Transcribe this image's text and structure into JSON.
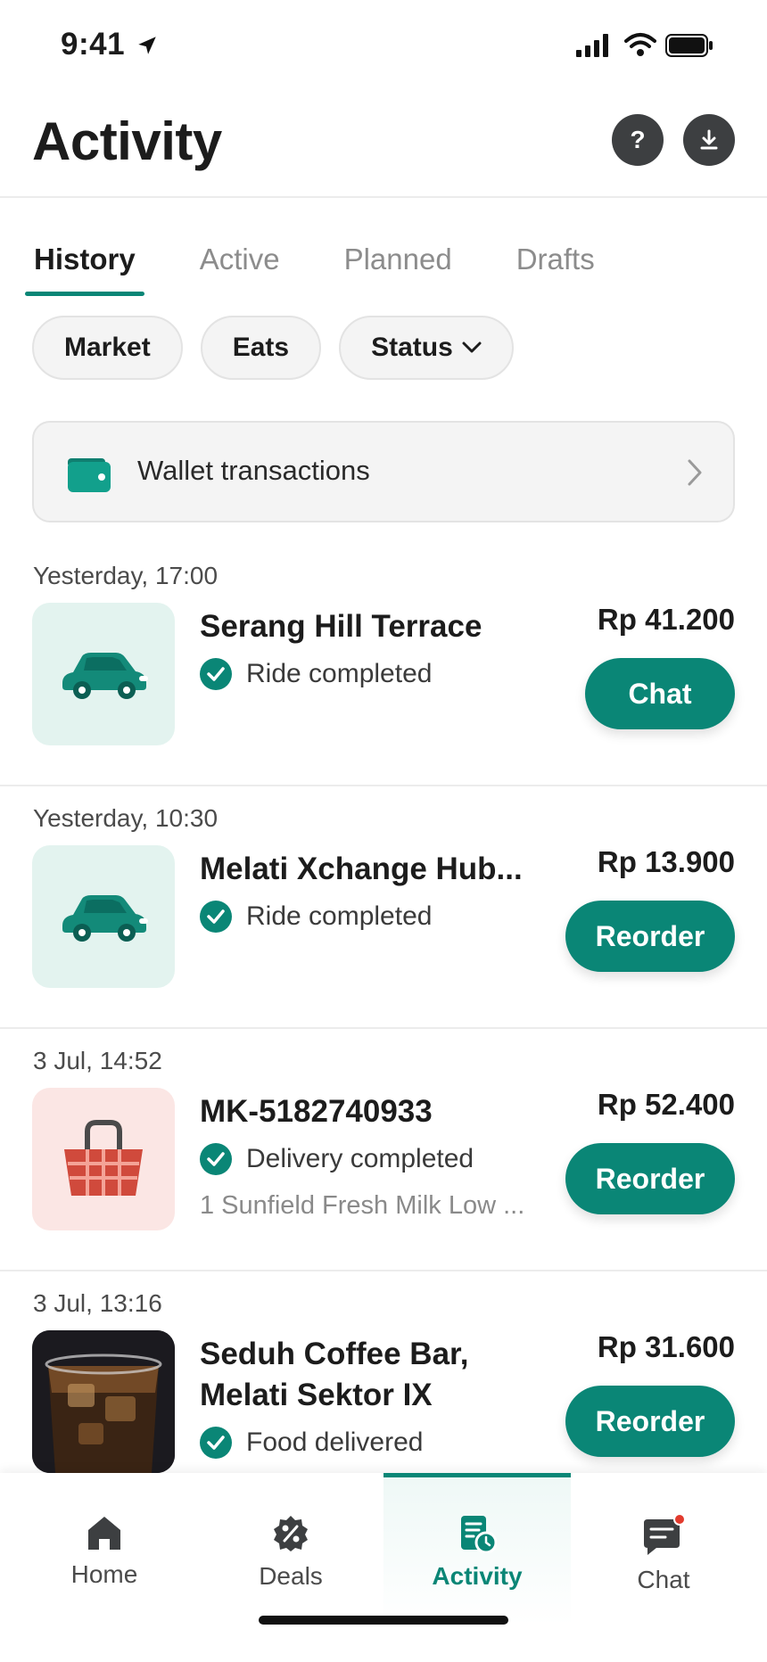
{
  "status_bar": {
    "time": "9:41"
  },
  "header": {
    "title": "Activity",
    "help_label": "?"
  },
  "tabs": [
    {
      "label": "History",
      "active": true
    },
    {
      "label": "Active"
    },
    {
      "label": "Planned"
    },
    {
      "label": "Drafts"
    }
  ],
  "filters": [
    {
      "label": "Market"
    },
    {
      "label": "Eats"
    },
    {
      "label": "Status",
      "has_dropdown": true
    }
  ],
  "wallet": {
    "label": "Wallet transactions",
    "icon": "wallet-icon"
  },
  "activities": [
    {
      "date": "Yesterday, 17:00",
      "title": "Serang Hill Terrace",
      "status": "Ride completed",
      "price": "Rp 41.200",
      "action": "Chat",
      "thumb": "car-icon"
    },
    {
      "date": "Yesterday, 10:30",
      "title": "Melati Xchange Hub...",
      "status": "Ride completed",
      "price": "Rp 13.900",
      "action": "Reorder",
      "thumb": "car-icon"
    },
    {
      "date": "3 Jul, 14:52",
      "title": "MK-5182740933",
      "status": "Delivery completed",
      "subtitle": "1 Sunfield Fresh Milk Low ...",
      "price": "Rp 52.400",
      "action": "Reorder",
      "thumb": "basket-icon"
    },
    {
      "date": "3 Jul, 13:16",
      "title_line1": "Seduh Coffee Bar,",
      "title_line2": "Melati Sektor IX",
      "status": "Food delivered",
      "price": "Rp 31.600",
      "action": "Reorder",
      "thumb": "iced-coffee-photo"
    }
  ],
  "bottom_nav": [
    {
      "label": "Home",
      "icon": "home-icon"
    },
    {
      "label": "Deals",
      "icon": "deals-icon"
    },
    {
      "label": "Activity",
      "icon": "activity-icon",
      "active": true
    },
    {
      "label": "Chat",
      "icon": "chat-icon",
      "has_notification_dot": true
    }
  ],
  "colors": {
    "accent": "#0a8676",
    "ride_bg": "#e3f3ef",
    "market_bg": "#fbe6e4",
    "notification_dot": "#e23b2e"
  }
}
